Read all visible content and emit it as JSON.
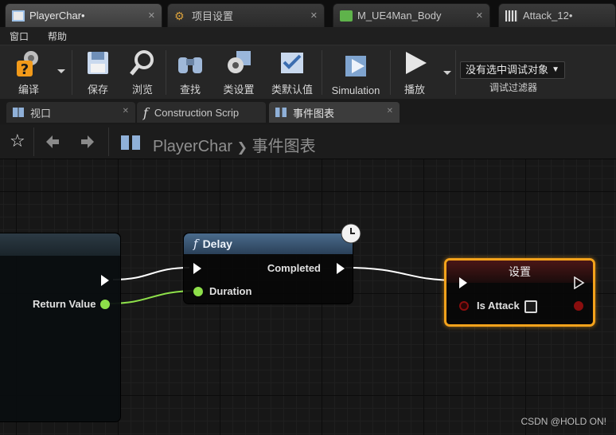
{
  "tabs": [
    {
      "label": "PlayerChar•",
      "active": true
    },
    {
      "label": "项目设置",
      "active": false
    },
    {
      "label": "M_UE4Man_Body",
      "active": false
    },
    {
      "label": "Attack_12•",
      "active": false
    }
  ],
  "menu": {
    "window": "窗口",
    "help": "帮助"
  },
  "toolbar": {
    "compile": "编译",
    "save": "保存",
    "browse": "浏览",
    "find": "查找",
    "class_settings": "类设置",
    "class_defaults": "类默认值",
    "simulation": "Simulation",
    "play": "播放",
    "debug_object": "没有选中调试对象",
    "debug_filter": "调试过滤器"
  },
  "panel_tabs": {
    "viewport": "视口",
    "construction": "Construction Scrip",
    "event_graph": "事件图表"
  },
  "breadcrumb": {
    "blueprint": "PlayerChar",
    "separator": "❯",
    "graph": "事件图表"
  },
  "graph": {
    "left_node": {
      "return_value": "Return Value"
    },
    "delay_node": {
      "title": "Delay",
      "completed": "Completed",
      "duration": "Duration"
    },
    "set_node": {
      "title": "设置",
      "variable": "Is Attack"
    }
  },
  "watermark": "CSDN @HOLD ON!",
  "colors": {
    "exec_wire": "#ffffff",
    "float_wire": "#8ee04a",
    "bool_pin": "#8a0e0e",
    "selection": "#f4a21b"
  }
}
